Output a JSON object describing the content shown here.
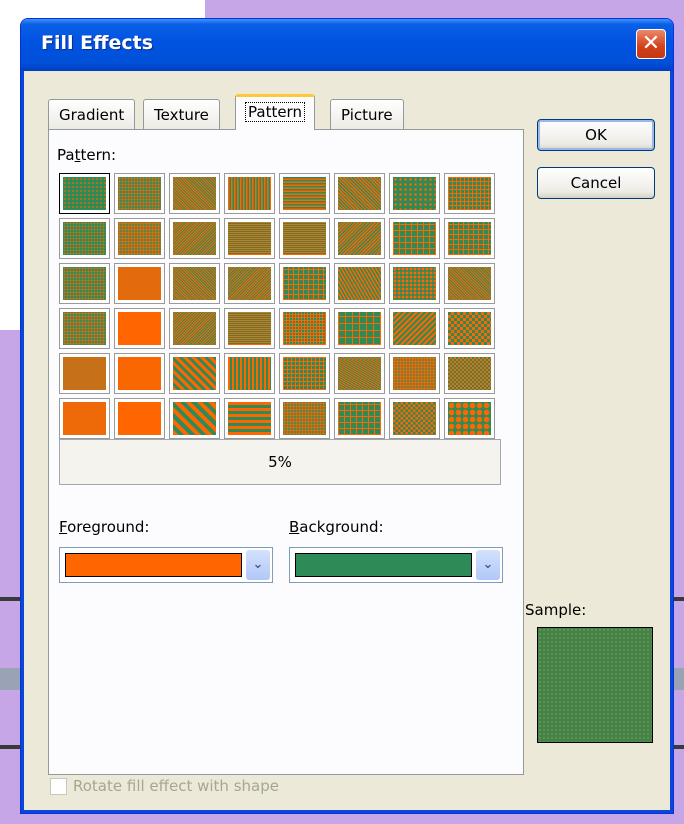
{
  "dialog": {
    "title": "Fill Effects",
    "close_label": "✕"
  },
  "tabs": [
    {
      "label": "Gradient"
    },
    {
      "label": "Texture"
    },
    {
      "label": "Pattern",
      "active": true
    },
    {
      "label": "Picture"
    }
  ],
  "pattern": {
    "label_pre": "Pa",
    "label_key": "t",
    "label_post": "tern:",
    "selected_name": "5%"
  },
  "foreground": {
    "label_key": "F",
    "label_rest": "oreground:",
    "color": "#ff6600"
  },
  "background": {
    "label_key": "B",
    "label_rest": "ackground:",
    "color": "#2e8b57"
  },
  "buttons": {
    "ok": "OK",
    "cancel": "Cancel"
  },
  "sample": {
    "label": "Sample:"
  },
  "rotate": {
    "label": "Rotate fill effect with shape",
    "checked": false,
    "enabled": false
  }
}
